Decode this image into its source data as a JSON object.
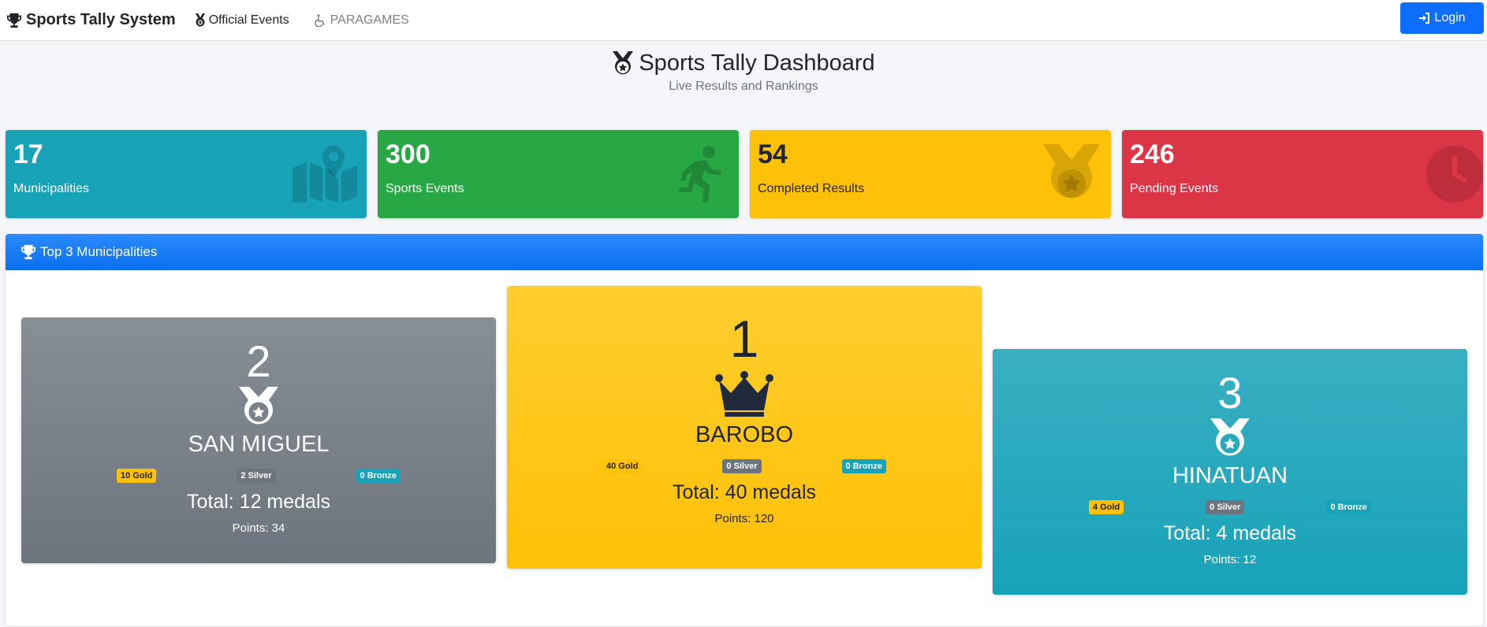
{
  "nav": {
    "brand": "Sports Tally System",
    "links": [
      {
        "label": "Official Events",
        "icon": "medal-icon"
      },
      {
        "label": "PARAGAMES",
        "icon": "wheelchair-icon"
      }
    ],
    "login": "Login"
  },
  "header": {
    "title": "Sports Tally Dashboard",
    "subtitle": "Live Results and Rankings"
  },
  "stats": [
    {
      "value": "17",
      "label": "Municipalities",
      "color": "#17a2b8",
      "icon": "map-icon"
    },
    {
      "value": "300",
      "label": "Sports Events",
      "color": "#28a745",
      "icon": "running-icon"
    },
    {
      "value": "54",
      "label": "Completed Results",
      "color": "#ffc107",
      "icon": "medal-icon"
    },
    {
      "value": "246",
      "label": "Pending Events",
      "color": "#dc3545",
      "icon": "clock-icon"
    }
  ],
  "top3": {
    "title": "Top 3 Municipalities",
    "places": [
      {
        "rank": "2",
        "name": "SAN MIGUEL",
        "gold": "10 Gold",
        "silver": "2 Silver",
        "bronze": "0 Bronze",
        "total": "Total: 12 medals",
        "points": "Points: 34"
      },
      {
        "rank": "1",
        "name": "BAROBO",
        "gold": "40 Gold",
        "silver": "0 Silver",
        "bronze": "0 Bronze",
        "total": "Total: 40 medals",
        "points": "Points: 120"
      },
      {
        "rank": "3",
        "name": "HINATUAN",
        "gold": "4 Gold",
        "silver": "0 Silver",
        "bronze": "0 Bronze",
        "total": "Total: 4 medals",
        "points": "Points: 12"
      }
    ]
  },
  "colors": {
    "primary": "#0d6efd",
    "info": "#17a2b8",
    "success": "#28a745",
    "warning": "#ffc107",
    "danger": "#dc3545",
    "secondary": "#6c757d"
  }
}
